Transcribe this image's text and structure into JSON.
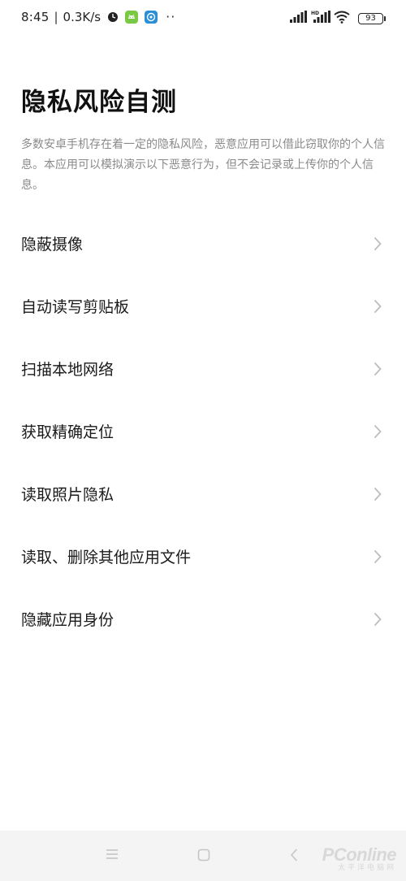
{
  "status_bar": {
    "time": "8:45",
    "separator": "|",
    "net_speed": "0.3K/s",
    "more": "··",
    "battery": "93",
    "icons": [
      "location-icon",
      "android-debug-icon",
      "app-notification-icon",
      "signal-icon",
      "hd-signal-icon",
      "wifi-icon",
      "battery-icon"
    ]
  },
  "header": {
    "title": "隐私风险自测",
    "description": "多数安卓手机存在着一定的隐私风险，恶意应用可以借此窃取你的个人信息。本应用可以模拟演示以下恶意行为，但不会记录或上传你的个人信息。"
  },
  "menu": {
    "items": [
      {
        "label": "隐蔽摄像"
      },
      {
        "label": "自动读写剪贴板"
      },
      {
        "label": "扫描本地网络"
      },
      {
        "label": "获取精确定位"
      },
      {
        "label": "读取照片隐私"
      },
      {
        "label": "读取、删除其他应用文件"
      },
      {
        "label": "隐藏应用身份"
      }
    ]
  },
  "nav_bar": {
    "icons": [
      "menu-icon",
      "home-icon",
      "back-icon"
    ]
  },
  "watermark": {
    "main": "PConline",
    "sub": "太平洋电脑网"
  },
  "colors": {
    "background": "#ffffff",
    "title": "#111111",
    "description": "#8a8a8a",
    "chevron": "#bdbdbd",
    "nav_bar": "#f4f4f4"
  }
}
